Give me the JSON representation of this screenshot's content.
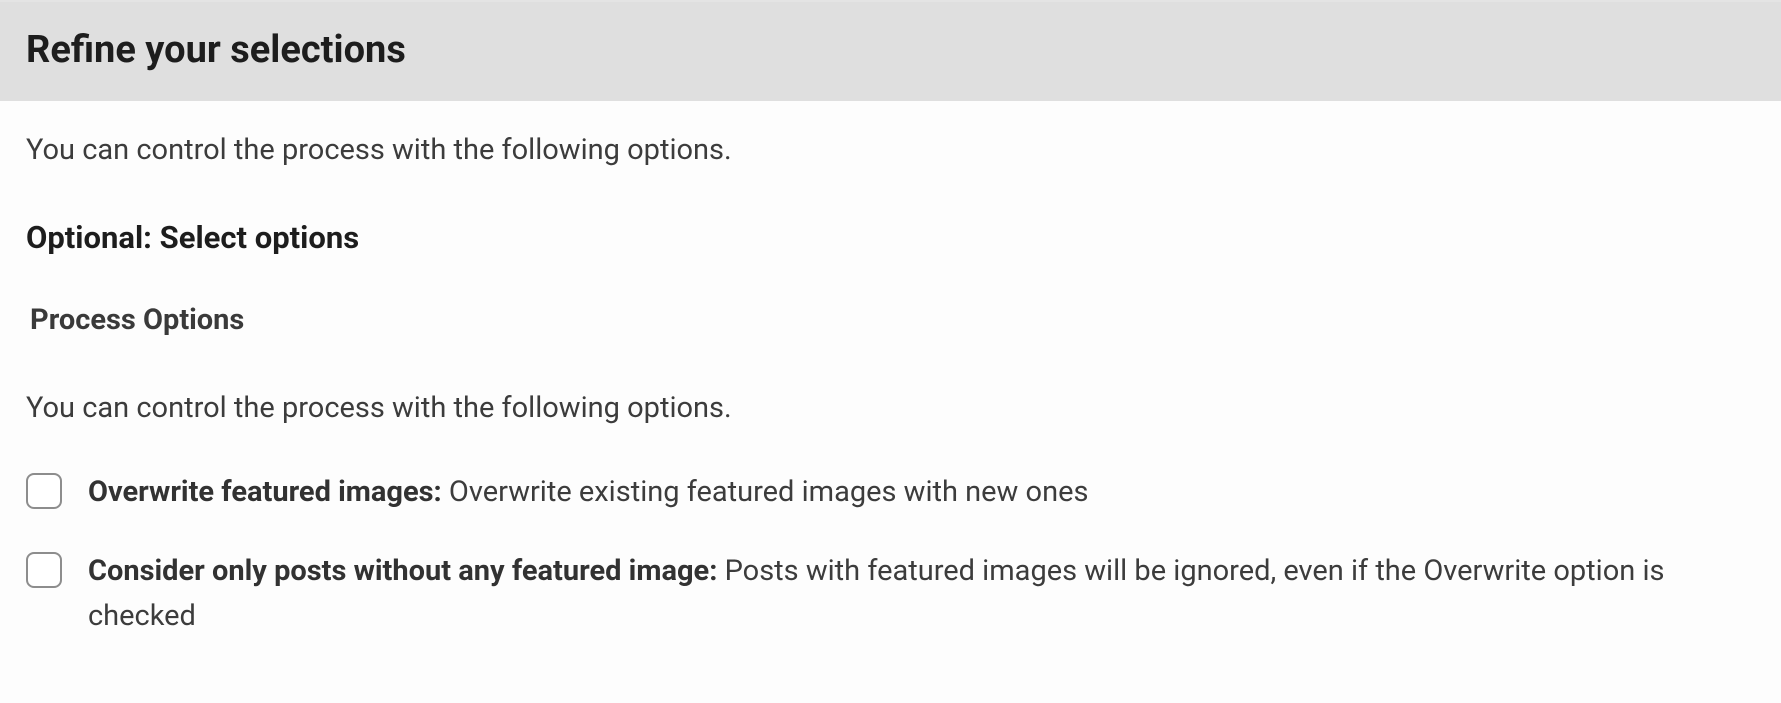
{
  "header": {
    "title": "Refine your selections"
  },
  "intro": "You can control the process with the following options.",
  "subheading": "Optional: Select options",
  "processOptions": {
    "label": "Process Options",
    "description": "You can control the process with the following options.",
    "items": [
      {
        "boldLabel": "Overwrite featured images:",
        "desc": " Overwrite existing featured images with new ones"
      },
      {
        "boldLabel": "Consider only posts without any featured image:",
        "desc": " Posts with featured images will be ignored, even if the Overwrite option is checked"
      }
    ]
  }
}
